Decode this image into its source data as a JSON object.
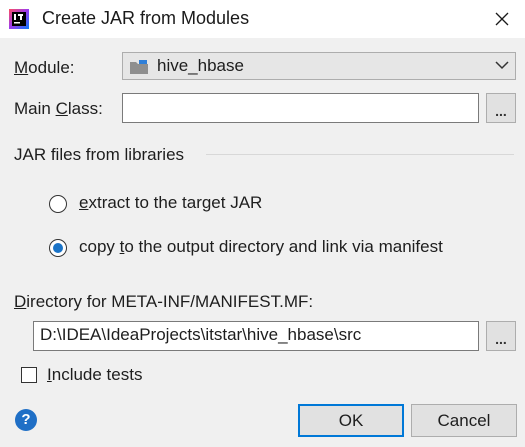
{
  "window": {
    "title": "Create JAR from Modules",
    "close_icon": "close-icon",
    "app_icon": "intellij-idea-icon"
  },
  "module": {
    "label_prefix": "",
    "label_mnemonic": "M",
    "label_rest": "odule:",
    "selected": "hive_hbase",
    "icon": "module-folder-icon"
  },
  "main_class": {
    "label_prefix": "Main ",
    "label_mnemonic": "C",
    "label_rest": "lass:",
    "value": "",
    "browse_label": "..."
  },
  "libraries": {
    "section_title": "JAR files from libraries",
    "option_extract": {
      "mnemonic": "e",
      "rest": "xtract to the target JAR",
      "selected": false
    },
    "option_copy": {
      "before": "copy ",
      "mnemonic": "t",
      "rest": "o the output directory and link via manifest",
      "selected": true
    }
  },
  "manifest_dir": {
    "label_mnemonic": "D",
    "label_rest": "irectory for META-INF/MANIFEST.MF:",
    "value": "D:\\IDEA\\IdeaProjects\\itstar\\hive_hbase\\src",
    "browse_label": "..."
  },
  "include_tests": {
    "label_mnemonic": "I",
    "label_rest": "nclude tests",
    "checked": false
  },
  "footer": {
    "help_icon": "help-icon",
    "help_glyph": "?",
    "ok_label": "OK",
    "cancel_label": "Cancel"
  },
  "colors": {
    "accent": "#0078d7",
    "help": "#1f6fc6",
    "radio_dot": "#1a73c7"
  }
}
